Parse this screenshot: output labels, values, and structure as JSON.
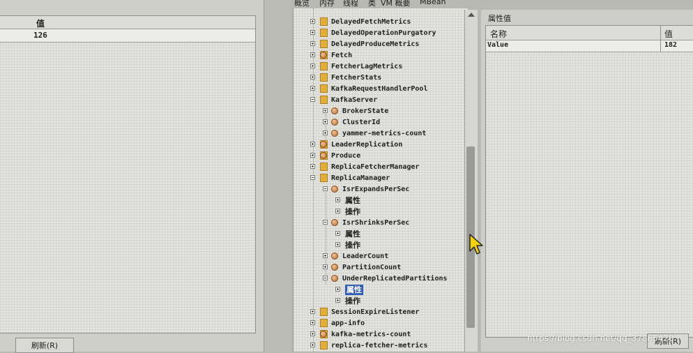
{
  "tabs": [
    "概览",
    "内存",
    "线程",
    "类",
    "VM 概要",
    "MBean"
  ],
  "left_table": {
    "header": "值",
    "rows": [
      "126"
    ]
  },
  "left_button": "刷新(R)",
  "tree": [
    "DelayedFetchMetrics",
    "DelayedOperationPurgatory",
    "DelayedProduceMetrics",
    "Fetch",
    "FetcherLagMetrics",
    "FetcherStats",
    "KafkaRequestHandlerPool",
    "KafkaServer",
    "BrokerState",
    "ClusterId",
    "yammer-metrics-count",
    "LeaderReplication",
    "Produce",
    "ReplicaFetcherManager",
    "ReplicaManager",
    "IsrExpandsPerSec",
    "属性",
    "操作",
    "IsrShrinksPerSec",
    "属性",
    "操作",
    "LeaderCount",
    "PartitionCount",
    "UnderReplicatedPartitions",
    "属性",
    "操作",
    "SessionExpireListener",
    "app-info",
    "kafka-metrics-count",
    "replica-fetcher-metrics"
  ],
  "properties": {
    "title": "属性值",
    "col_name": "名称",
    "col_value": "值",
    "rows": [
      {
        "name": "Value",
        "value": "182"
      }
    ]
  },
  "prop_button": "刷新(R)",
  "watermark": "https://blog.csdn.net/qq_37865420"
}
